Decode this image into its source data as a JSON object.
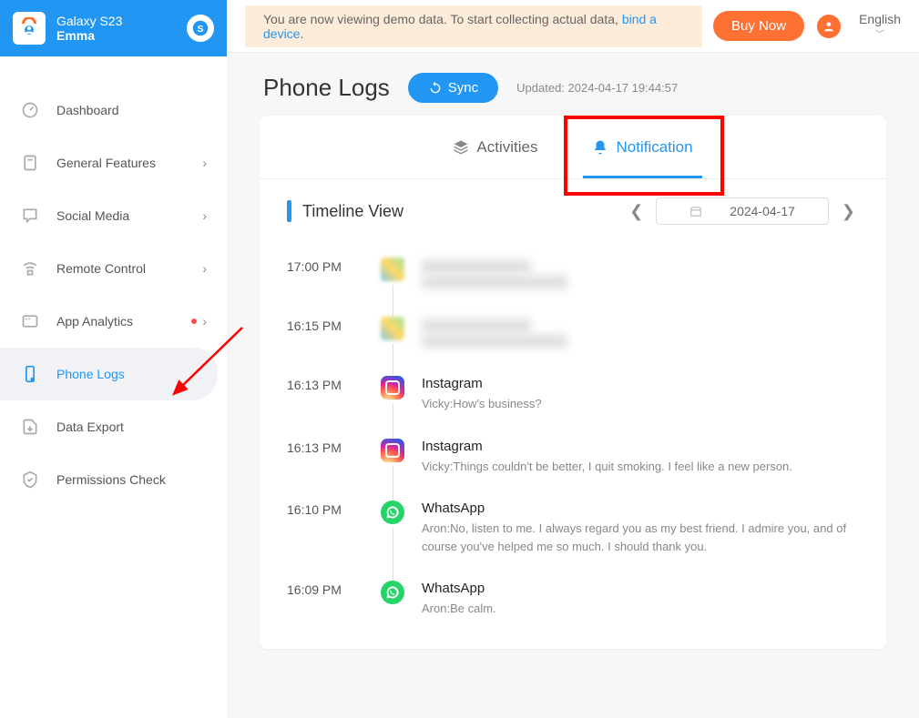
{
  "sidebar": {
    "device": "Galaxy S23",
    "user": "Emma",
    "items": [
      {
        "label": "Dashboard",
        "chevron": false
      },
      {
        "label": "General Features",
        "chevron": true
      },
      {
        "label": "Social Media",
        "chevron": true
      },
      {
        "label": "Remote Control",
        "chevron": true
      },
      {
        "label": "App Analytics",
        "chevron": true,
        "dot": true
      },
      {
        "label": "Phone Logs",
        "chevron": false,
        "active": true
      },
      {
        "label": "Data Export",
        "chevron": false
      },
      {
        "label": "Permissions Check",
        "chevron": false
      }
    ]
  },
  "top": {
    "demo_text_1": "You are now viewing demo data. To start collecting actual data, ",
    "demo_link": "bind a device",
    "demo_text_2": ".",
    "buy": "Buy Now",
    "lang": "English"
  },
  "page": {
    "title": "Phone Logs",
    "sync": "Sync",
    "updated": "Updated: 2024-04-17 19:44:57"
  },
  "tabs": {
    "activities": "Activities",
    "notification": "Notification"
  },
  "timeline": {
    "title": "Timeline View",
    "date": "2024-04-17",
    "entries": [
      {
        "time": "17:00 PM",
        "app": "",
        "text": "",
        "blurred": true
      },
      {
        "time": "16:15 PM",
        "app": "",
        "text": "",
        "blurred": true
      },
      {
        "time": "16:13 PM",
        "app": "Instagram",
        "text": "Vicky:How's business?",
        "icon": "instagram"
      },
      {
        "time": "16:13 PM",
        "app": "Instagram",
        "text": "Vicky:Things couldn't be better, I quit smoking. I feel like a new person.",
        "icon": "instagram"
      },
      {
        "time": "16:10 PM",
        "app": "WhatsApp",
        "text": "Aron:No, listen to me. I always regard you as my best friend. I admire you, and of course you've helped me so much. I should thank you.",
        "icon": "whatsapp"
      },
      {
        "time": "16:09 PM",
        "app": "WhatsApp",
        "text": "Aron:Be calm.",
        "icon": "whatsapp"
      }
    ]
  }
}
